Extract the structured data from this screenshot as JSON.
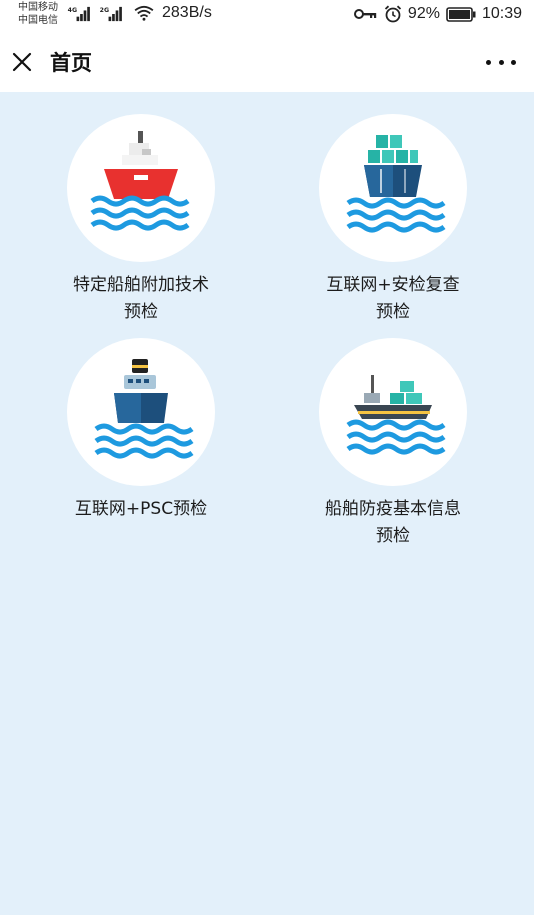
{
  "status_bar": {
    "carrier_1": "中国移动",
    "carrier_2": "中国电信",
    "net_1": "4G",
    "net_2": "2G",
    "speed": "283B/s",
    "battery": "92%",
    "time": "10:39",
    "icons": [
      "signal-icon",
      "wifi-icon",
      "key-icon",
      "alarm-icon",
      "battery-icon"
    ]
  },
  "nav": {
    "title": "首页",
    "close_icon": "close-icon",
    "more_icon": "more-icon"
  },
  "tiles": [
    {
      "label": "特定船舶附加技术\n预检",
      "icon": "red-ship-icon"
    },
    {
      "label": "互联网+安检复查\n预检",
      "icon": "container-ship-icon"
    },
    {
      "label": "互联网+PSC预检",
      "icon": "navy-ship-icon"
    },
    {
      "label": "船舶防疫基本信息\n预检",
      "icon": "cargo-ship-icon"
    }
  ],
  "colors": {
    "content_bg": "#e3f0fa",
    "wave_blue": "#1e9ae0",
    "ship_red": "#e8312f",
    "ship_navy": "#1d4f7c",
    "container_teal": "#26b3a6"
  }
}
